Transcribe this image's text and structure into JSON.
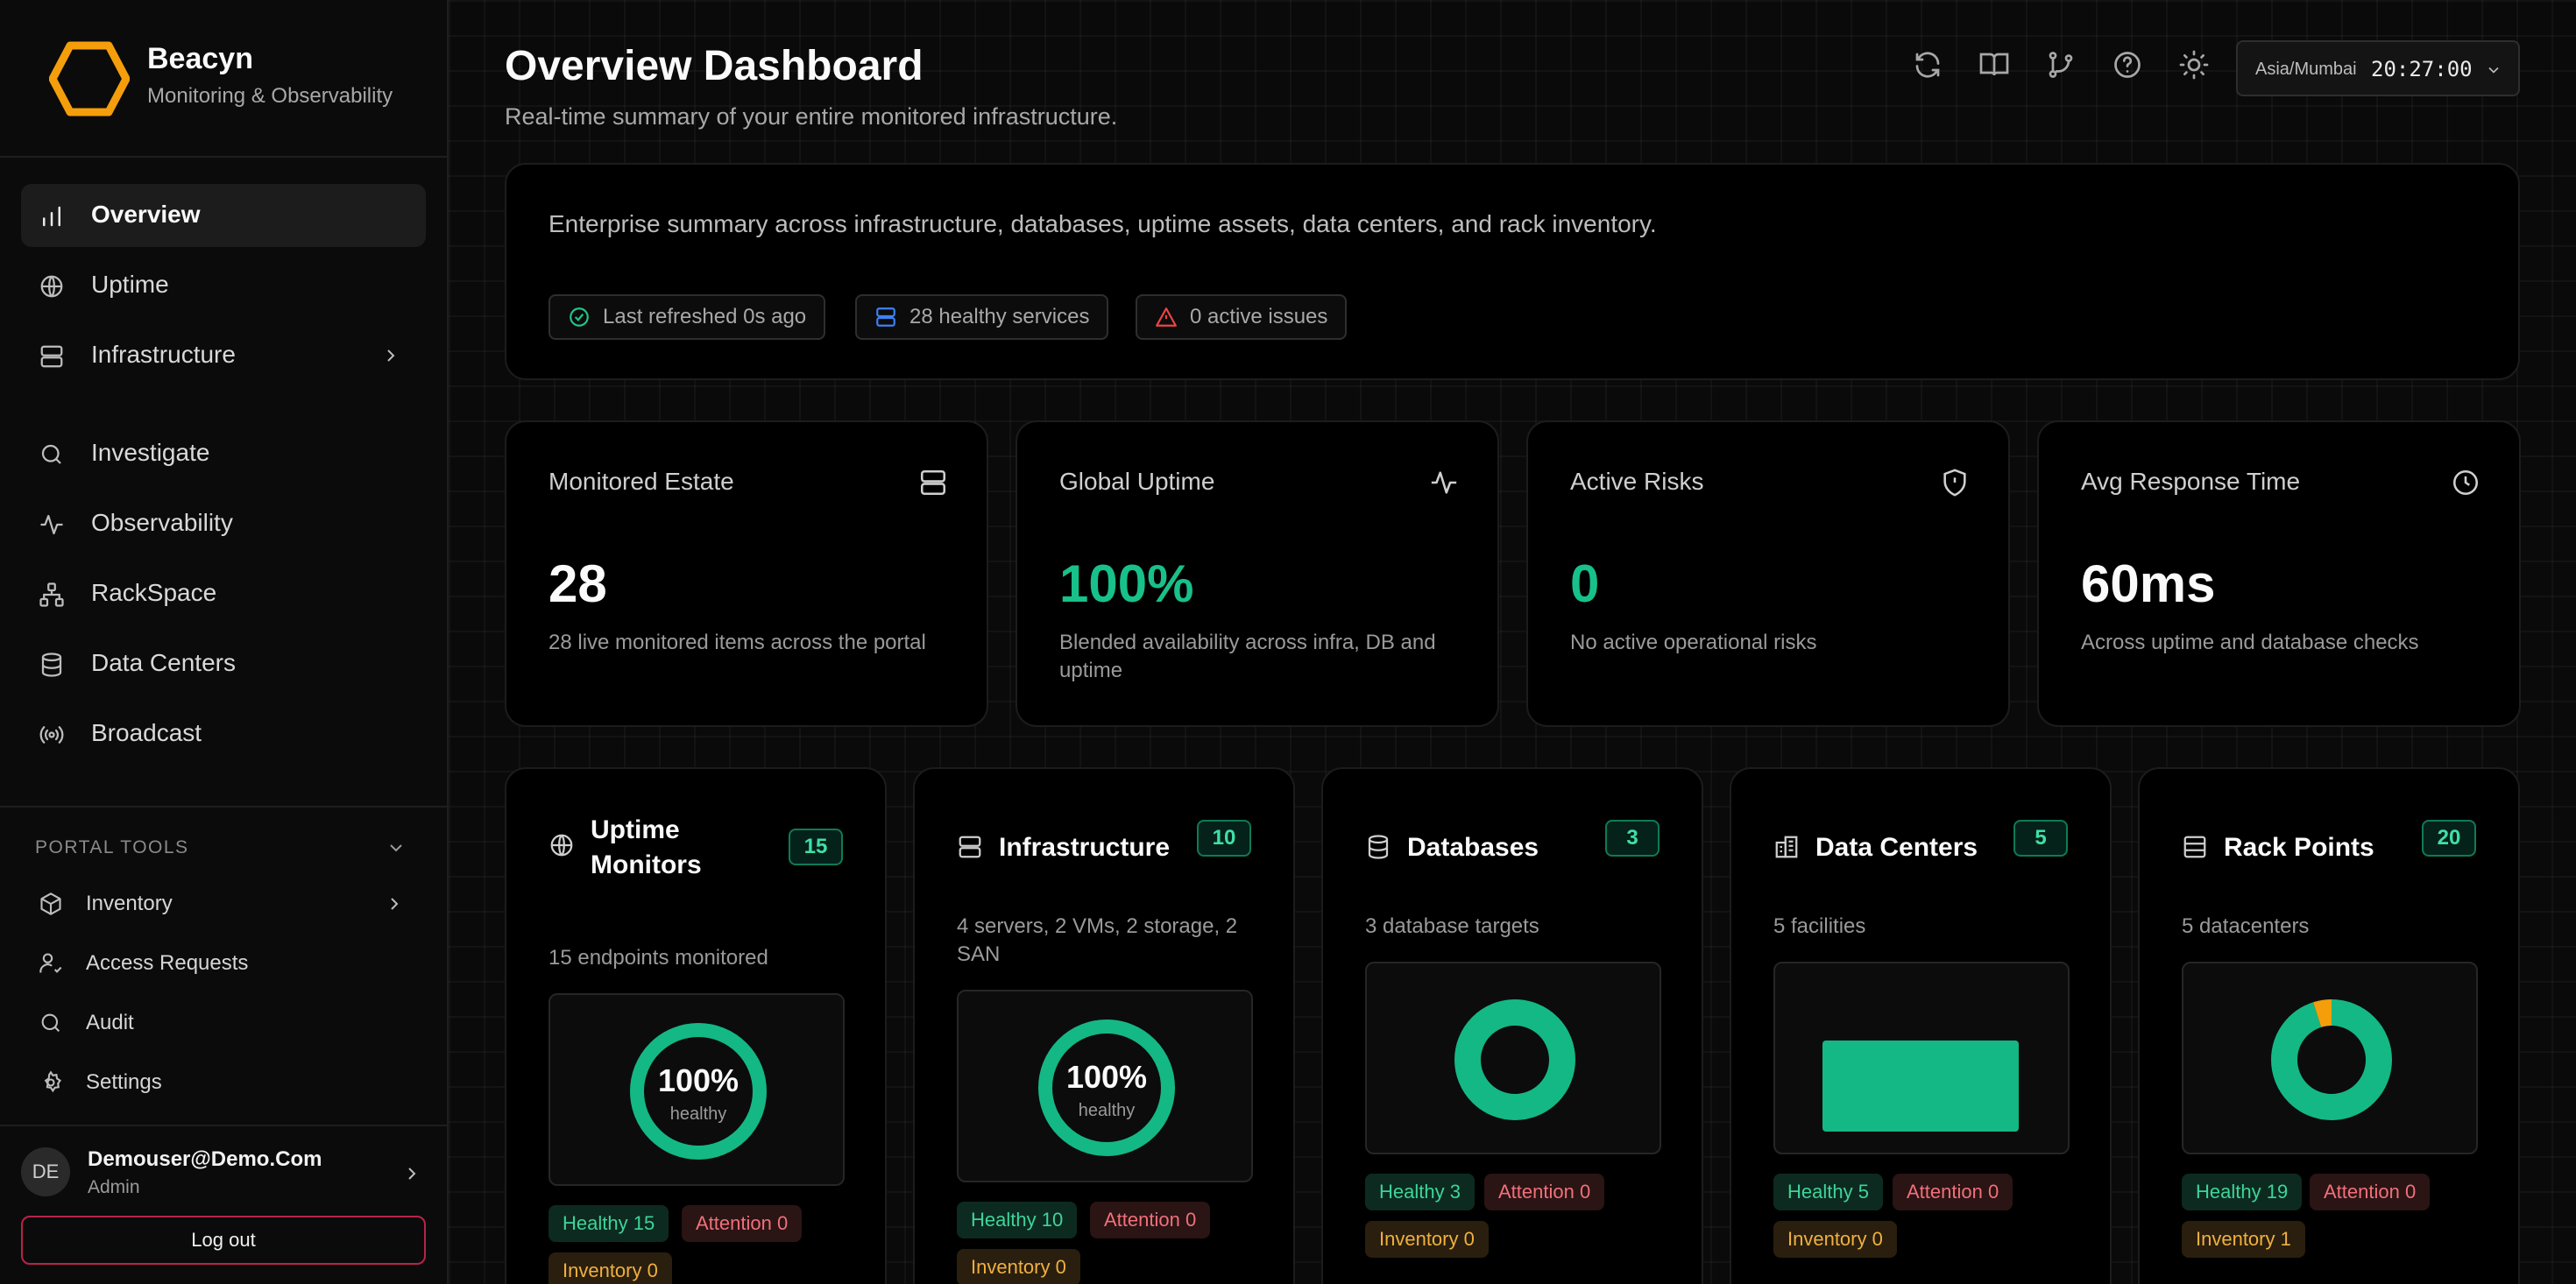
{
  "brand": {
    "title": "Beacyn",
    "subtitle": "Monitoring & Observability",
    "logo_icon": "hexagon-logo-icon",
    "logo_color": "#f59e0b"
  },
  "nav": {
    "items": [
      {
        "label": "Overview",
        "icon": "bar-chart-icon",
        "active": true
      },
      {
        "label": "Uptime",
        "icon": "globe-icon"
      },
      {
        "label": "Infrastructure",
        "icon": "server-icon",
        "has_children": true
      },
      {
        "label": "Investigate",
        "icon": "search-icon"
      },
      {
        "label": "Observability",
        "icon": "activity-icon"
      },
      {
        "label": "RackSpace",
        "icon": "network-icon"
      },
      {
        "label": "Data Centers",
        "icon": "database-icon"
      },
      {
        "label": "Broadcast",
        "icon": "broadcast-icon"
      }
    ]
  },
  "tools": {
    "title": "PORTAL TOOLS",
    "items": [
      {
        "label": "Inventory",
        "icon": "box-icon",
        "has_children": true
      },
      {
        "label": "Access Requests",
        "icon": "user-check-icon"
      },
      {
        "label": "Audit",
        "icon": "search-icon"
      },
      {
        "label": "Settings",
        "icon": "gear-icon"
      }
    ]
  },
  "user": {
    "initials": "DE",
    "name": "Demouser@Demo.Com",
    "role": "Admin",
    "logout_label": "Log out"
  },
  "header": {
    "title": "Overview Dashboard",
    "subtitle": "Real-time summary of your entire monitored infrastructure.",
    "icons": [
      "refresh-icon",
      "book-icon",
      "git-branch-icon",
      "help-icon",
      "sun-icon"
    ],
    "timezone": "Asia/Mumbai",
    "time": "20:27:00"
  },
  "summary": {
    "text": "Enterprise summary across infrastructure, databases, uptime assets, data centers, and rack inventory.",
    "pills": [
      {
        "label": "Last refreshed 0s ago",
        "icon": "check-circle-icon",
        "color": "#22c58b"
      },
      {
        "label": "28 healthy services",
        "icon": "server-icon",
        "color": "#3b82f6"
      },
      {
        "label": "0 active issues",
        "icon": "alert-triangle-icon",
        "color": "#ef4444"
      }
    ]
  },
  "stats": [
    {
      "title": "Monitored Estate",
      "value": "28",
      "desc": "28 live monitored items across the portal",
      "icon": "server-icon"
    },
    {
      "title": "Global Uptime",
      "value": "100%",
      "desc": "Blended availability across infra, DB and uptime",
      "icon": "activity-icon",
      "accent": "#18c08a"
    },
    {
      "title": "Active Risks",
      "value": "0",
      "desc": "No active operational risks",
      "icon": "shield-icon",
      "accent": "#18c08a"
    },
    {
      "title": "Avg Response Time",
      "value": "60ms",
      "desc": "Across uptime and database checks",
      "icon": "clock-icon"
    }
  ],
  "cards": [
    {
      "title": "Uptime Monitors",
      "count": "15",
      "desc": "15 endpoints monitored",
      "icon": "globe-icon",
      "viz": {
        "type": "ring",
        "percent": "100%",
        "label": "healthy",
        "fraction": 1.0
      },
      "tags": {
        "healthy": "Healthy 15",
        "attention": "Attention 0",
        "inventory": "Inventory 0"
      }
    },
    {
      "title": "Infrastructure",
      "count": "10",
      "desc": "4 servers, 2 VMs, 2 storage, 2 SAN",
      "icon": "server-icon",
      "viz": {
        "type": "ring",
        "percent": "100%",
        "label": "healthy",
        "fraction": 1.0
      },
      "tags": {
        "healthy": "Healthy 10",
        "attention": "Attention 0",
        "inventory": "Inventory 0"
      }
    },
    {
      "title": "Databases",
      "count": "3",
      "desc": "3 database targets",
      "icon": "database-icon",
      "viz": {
        "type": "donut",
        "fraction": 1.0
      },
      "tags": {
        "healthy": "Healthy 3",
        "attention": "Attention 0",
        "inventory": "Inventory 0"
      }
    },
    {
      "title": "Data Centers",
      "count": "5",
      "desc": "5 facilities",
      "icon": "building-icon",
      "viz": {
        "type": "bar",
        "fraction": 1.0
      },
      "tags": {
        "healthy": "Healthy 5",
        "attention": "Attention 0",
        "inventory": "Inventory 0"
      }
    },
    {
      "title": "Rack Points",
      "count": "20",
      "desc": "5 datacenters",
      "icon": "list-icon",
      "viz": {
        "type": "donut",
        "fraction": 0.95,
        "secondary_fraction": 0.05
      },
      "tags": {
        "healthy": "Healthy 19",
        "attention": "Attention 0",
        "inventory": "Inventory 1"
      }
    }
  ],
  "colors": {
    "accent": "#18c08a",
    "warning": "#f59e0b",
    "danger": "#ef4444"
  }
}
